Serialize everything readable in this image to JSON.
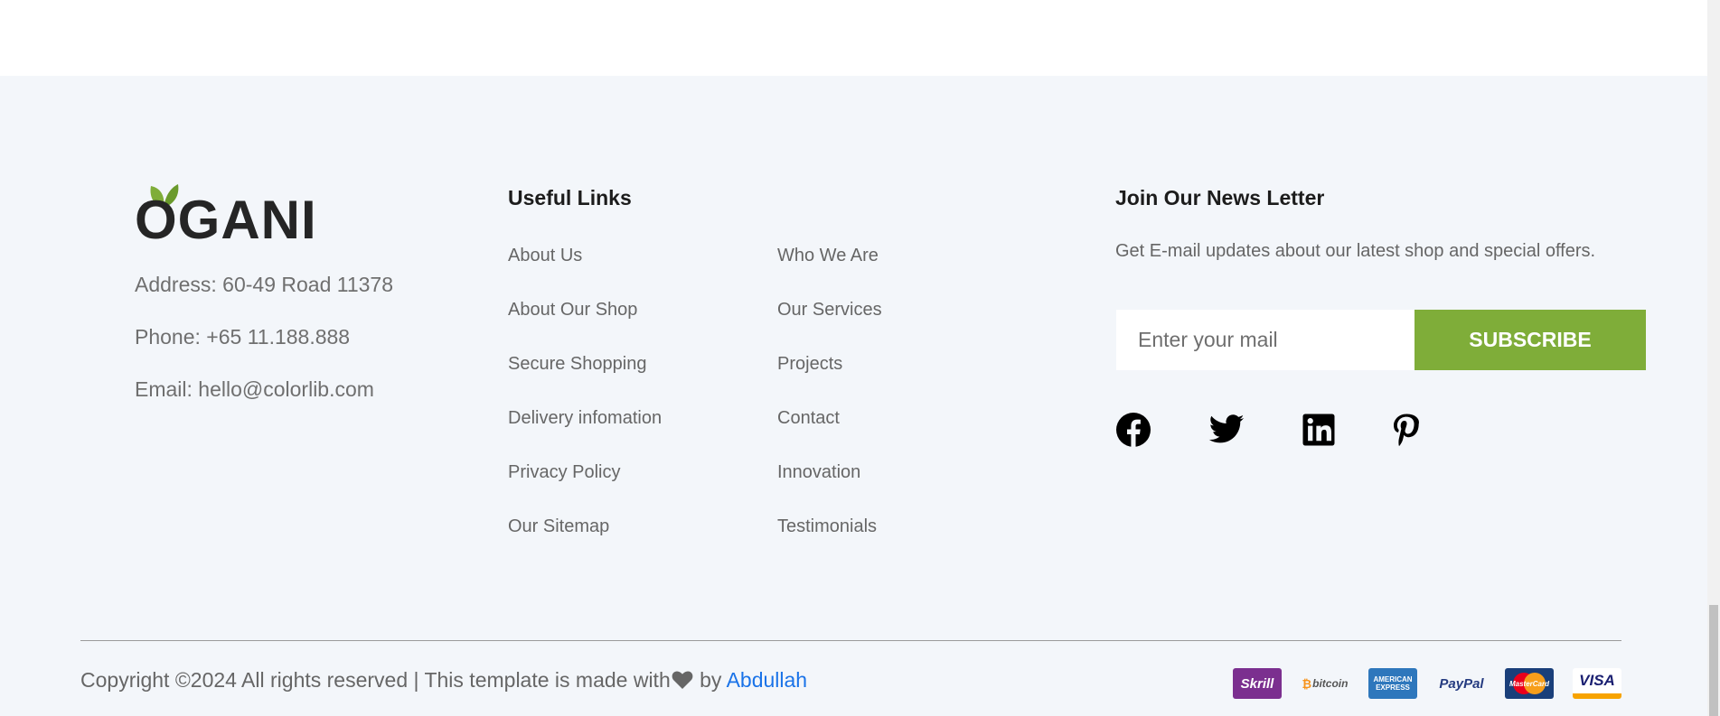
{
  "brand": {
    "name": "OGANI",
    "leaf_color": "#7fad39",
    "text_color": "#252525"
  },
  "contact": {
    "address": "Address: 60-49 Road 11378",
    "phone": "Phone: +65 11.188.888",
    "email": "Email: hello@colorlib.com"
  },
  "useful_links": {
    "title": "Useful Links",
    "col1": [
      "About Us",
      "About Our Shop",
      "Secure Shopping",
      "Delivery infomation",
      "Privacy Policy",
      "Our Sitemap"
    ],
    "col2": [
      "Who We Are",
      "Our Services",
      "Projects",
      "Contact",
      "Innovation",
      "Testimonials"
    ]
  },
  "newsletter": {
    "title": "Join Our News Letter",
    "description": "Get E-mail updates about our latest shop and special offers.",
    "placeholder": "Enter your mail",
    "button_label": "SUBSCRIBE",
    "accent": "#7fad39"
  },
  "social": [
    "facebook-icon",
    "twitter-icon",
    "linkedin-icon",
    "pinterest-icon"
  ],
  "copyright": {
    "text": "Copyright ©2024 All rights reserved | This template is made with",
    "by": " by ",
    "author": "Abdullah"
  },
  "payments": {
    "skrill": "Skrill",
    "bitcoin": "bitcoin",
    "amex_line1": "AMERICAN",
    "amex_line2": "EXPRESS",
    "paypal": "PayPal",
    "mastercard": "MasterCard",
    "visa": "VISA"
  }
}
